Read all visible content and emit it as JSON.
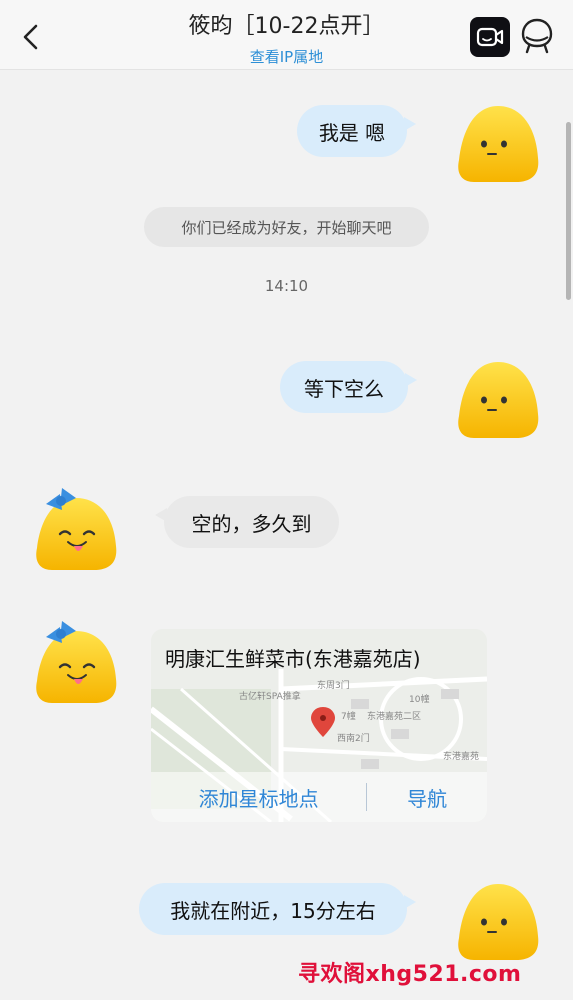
{
  "header": {
    "title": "筱昀［10-22点开］",
    "subtitle": "查看IP属地"
  },
  "messages": {
    "m1": "我是 嗯",
    "system": "你们已经成为好友，开始聊天吧",
    "time": "14:10",
    "m2": "等下空么",
    "m3": "空的，多久到",
    "m5": "我就在附近，15分左右"
  },
  "map_card": {
    "title": "明康汇生鲜菜市(东港嘉苑店)",
    "add_star": "添加星标地点",
    "navigate": "导航",
    "labels": {
      "l1": "东周3门",
      "l2": "古亿轩SPA推拿",
      "l3": "东港嘉苑二区",
      "l4": "西南2门",
      "l5": "东港嘉苑",
      "l6": "10幢",
      "l7": "7幢"
    }
  },
  "watermark": "寻欢阁xhg521.com",
  "colors": {
    "accent": "#2d8fd6",
    "bubble_out": "#d9ecfb",
    "bubble_in": "#e9e9e9",
    "watermark": "#e0103a"
  }
}
